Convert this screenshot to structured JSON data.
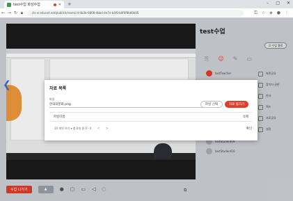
{
  "browser": {
    "tab_title": "test수업 화상수업",
    "new_tab": "+",
    "url": "cls-sr.edunet.net/publish/room/c4-4b3b-9808-4bbd-4e7e-b4f0-b0f0f8b60b05",
    "controls": {
      "minimize": "–",
      "maximize": "□",
      "close": "✕"
    }
  },
  "room": {
    "title": "test수업",
    "end_button": "수업 종료"
  },
  "users": [
    "testTeacher",
    "",
    "",
    "",
    "testStudent07",
    "testStudent08",
    "testStudent09",
    "testStudent10"
  ],
  "menu": [
    "화면공유",
    "참석자 권한",
    "판서",
    "퀴즈",
    "자료공유",
    "설정"
  ],
  "bottom": {
    "leave_label": "수업 나가기",
    "mic_label": "▲"
  },
  "modal": {
    "title": "자료 목록",
    "file_label": "파일",
    "file_value": "한국의문화.png",
    "select_button": "파일 선택",
    "upload_button": "자료 올리기",
    "row_name": "파일이름",
    "row_delete": "삭제",
    "pager_text": "10 개씩 보기  ▾     총 0개 중 0 - 0",
    "prev": "<",
    "next": ">",
    "confirm": "확인"
  },
  "colors": {
    "accent": "#e23c2a",
    "blue_arrow": "#3d6fd9"
  }
}
